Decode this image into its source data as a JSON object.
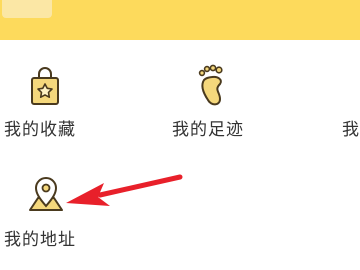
{
  "grid": {
    "items": [
      {
        "label": "我的收藏",
        "icon": "shopping-bag-star-icon"
      },
      {
        "label": "我的足迹",
        "icon": "footprint-icon"
      },
      {
        "label": "我的",
        "icon": ""
      },
      {
        "label": "我的地址",
        "icon": "location-pin-icon"
      }
    ]
  },
  "colors": {
    "header": "#fdda5c",
    "icon_stroke": "#4a3a1e",
    "icon_fill": "#f5d87c",
    "arrow": "#e8202a"
  }
}
